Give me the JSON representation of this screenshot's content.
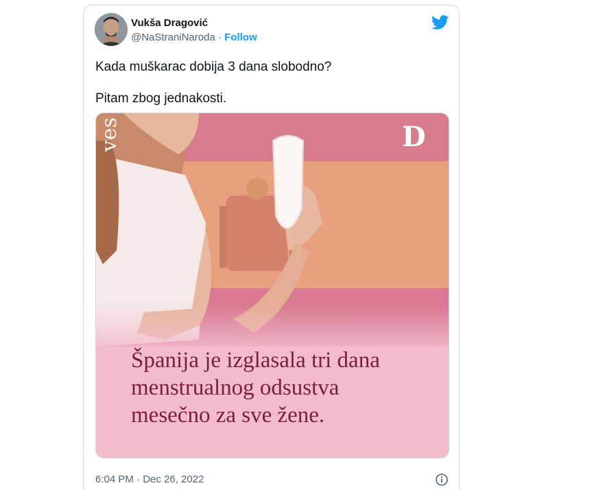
{
  "author": {
    "name": "Vukša Dragović",
    "handle": "@NaStraniNaroda",
    "separator": "·",
    "follow_label": "Follow"
  },
  "tweet": {
    "line1": "Kada muškarac dobija 3 dana slobodno?",
    "line2": "Pitam zbog jednakosti."
  },
  "media": {
    "headline_lines": [
      "Španija je izglasala tri dana",
      "menstrualnog odsustva",
      "mesečno za sve žene."
    ],
    "brand_mark": "D",
    "side_text": "ves"
  },
  "footer": {
    "timestamp": "6:04 PM · Dec 26, 2022"
  },
  "icons": {
    "logo": "twitter-bird-icon",
    "info": "info-icon"
  },
  "colors": {
    "twitter_blue": "#1d9bf0",
    "headline": "#7a1f3a",
    "media_pink": "#f0b8c8"
  }
}
